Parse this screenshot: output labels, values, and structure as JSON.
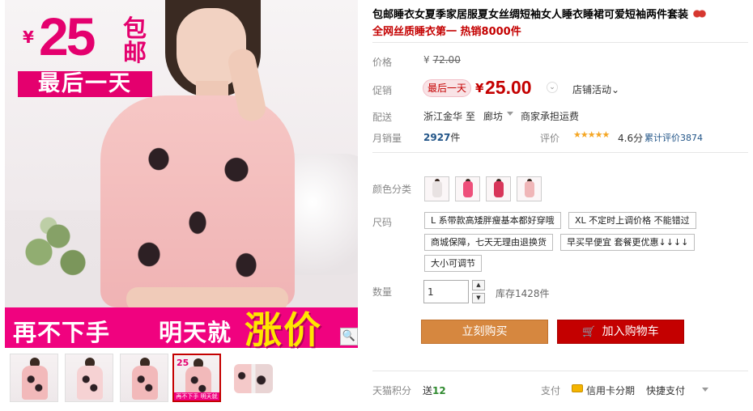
{
  "product": {
    "title": "包邮睡衣女夏季家居服夏女丝绸短袖女人睡衣睡裙可爱短袖两件套装",
    "subtitle": "全网丝质睡衣第一 热销8000件"
  },
  "gallery": {
    "promo_yen": "¥",
    "promo_price": "25",
    "promo_free_shipping": "包邮",
    "promo_last_day": "最后一天",
    "banner_part1": "再不下手",
    "banner_part2": "明天就",
    "banner_part3": "涨价",
    "thumb_promo": "25",
    "thumb_banner": "再不下手 明天就 涨价"
  },
  "price": {
    "label": "价格",
    "currency": "¥",
    "original": "72.00",
    "promo_label": "促销",
    "badge": "最后一天",
    "current": "25.00",
    "store_promo": "店铺活动"
  },
  "shipping": {
    "label": "配送",
    "from": "浙江金华",
    "to_word": "至",
    "destination": "廊坊",
    "fee_note": "商家承担运费"
  },
  "sales": {
    "label": "月销量",
    "count": "2927",
    "unit": "件",
    "rating_label": "评价",
    "stars": "★★★★★",
    "score": "4.6分",
    "review_count": "累计评价3874"
  },
  "color": {
    "label": "颜色分类",
    "options": [
      "white-print",
      "pink-print",
      "red-print",
      "pink-butterfly"
    ]
  },
  "size": {
    "label": "尺码",
    "options": [
      "L 系带款高矮胖瘦基本都好穿哦",
      "XL 不定时上调价格 不能错过",
      "商城保障，七天无理由退换货",
      "早买早便宜 套餐更优惠↓↓↓↓",
      "大小可调节"
    ]
  },
  "quantity": {
    "label": "数量",
    "value": "1",
    "up": "▲",
    "down": "▼",
    "stock": "库存1428件"
  },
  "actions": {
    "buy_now": "立刻购买",
    "add_to_cart": "加入购物车",
    "cart_icon": "cart-icon"
  },
  "footer": {
    "points_label": "天猫积分",
    "points_prefix": "送",
    "points_value": "12",
    "pay_label": "支付",
    "pay_option1": "信用卡分期",
    "pay_option2": "快捷支付"
  },
  "colors": {
    "accent_red": "#c40000",
    "promo_pink": "#e4006e",
    "buy_orange": "#d6873f",
    "link_blue": "#225588"
  }
}
